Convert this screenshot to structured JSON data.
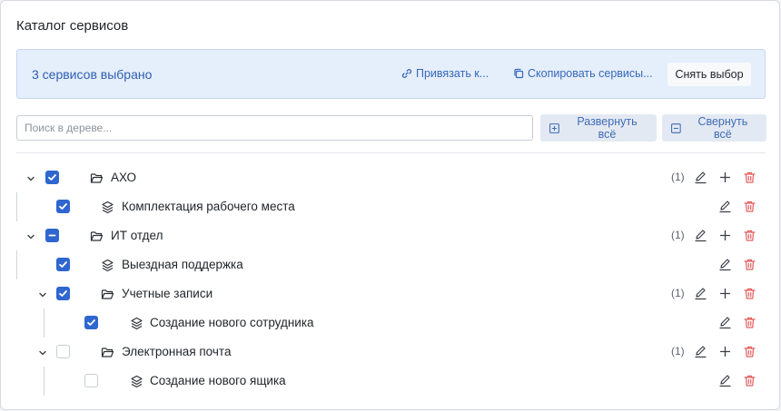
{
  "panel": {
    "title": "Каталог сервисов"
  },
  "selection": {
    "count_text": "3 сервисов выбрано",
    "bind_label": "Привязать к...",
    "copy_label": "Скопировать сервисы...",
    "clear_label": "Снять выбор"
  },
  "search": {
    "placeholder": "Поиск в дереве...",
    "value": ""
  },
  "tools": {
    "expand_label": "Развернуть всё",
    "collapse_label": "Свернуть всё"
  },
  "colors": {
    "accent": "#2f66d0",
    "danger": "#e35d5d",
    "selection_bg": "#e5eefb"
  },
  "tree": [
    {
      "label": "АХО",
      "type": "folder",
      "level": 0,
      "expanded": true,
      "checked": "checked",
      "count": "(1)"
    },
    {
      "label": "Комплектация рабочего места",
      "type": "service",
      "level": 1,
      "checked": "checked"
    },
    {
      "label": "ИТ отдел",
      "type": "folder",
      "level": 0,
      "expanded": true,
      "checked": "indeterminate",
      "count": "(1)"
    },
    {
      "label": "Выездная поддержка",
      "type": "service",
      "level": 1,
      "checked": "checked"
    },
    {
      "label": "Учетные записи",
      "type": "folder",
      "level": 1,
      "expanded": true,
      "checked": "checked",
      "count": "(1)"
    },
    {
      "label": "Создание нового сотрудника",
      "type": "service",
      "level": 2,
      "checked": "checked"
    },
    {
      "label": "Электронная почта",
      "type": "folder",
      "level": 1,
      "expanded": true,
      "checked": "unchecked",
      "count": "(1)"
    },
    {
      "label": "Создание нового ящика",
      "type": "service",
      "level": 2,
      "checked": "unchecked"
    }
  ]
}
